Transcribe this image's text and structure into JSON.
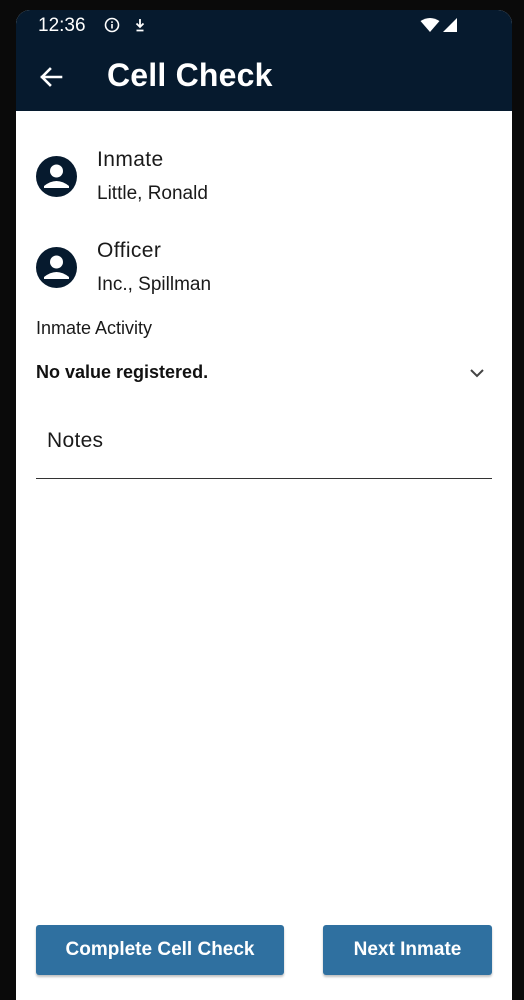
{
  "status_bar": {
    "time": "12:36",
    "icons": [
      "info-icon",
      "download-icon",
      "wifi-icon",
      "signal-icon"
    ]
  },
  "app_bar": {
    "title": "Cell Check",
    "back_icon": "arrow-back-icon",
    "background": "#061a2e"
  },
  "inmate": {
    "heading": "Inmate",
    "name": "Little, Ronald",
    "icon": "account-circle-icon"
  },
  "officer": {
    "heading": "Officer",
    "name": "Inc., Spillman",
    "icon": "account-circle-icon"
  },
  "activity": {
    "label": "Inmate Activity",
    "selected_value": "No value registered.",
    "icon": "chevron-down-icon"
  },
  "notes": {
    "placeholder": "Notes",
    "value": ""
  },
  "actions": {
    "complete_label": "Complete Cell Check",
    "next_label": "Next Inmate",
    "button_color": "#2f70a0"
  }
}
